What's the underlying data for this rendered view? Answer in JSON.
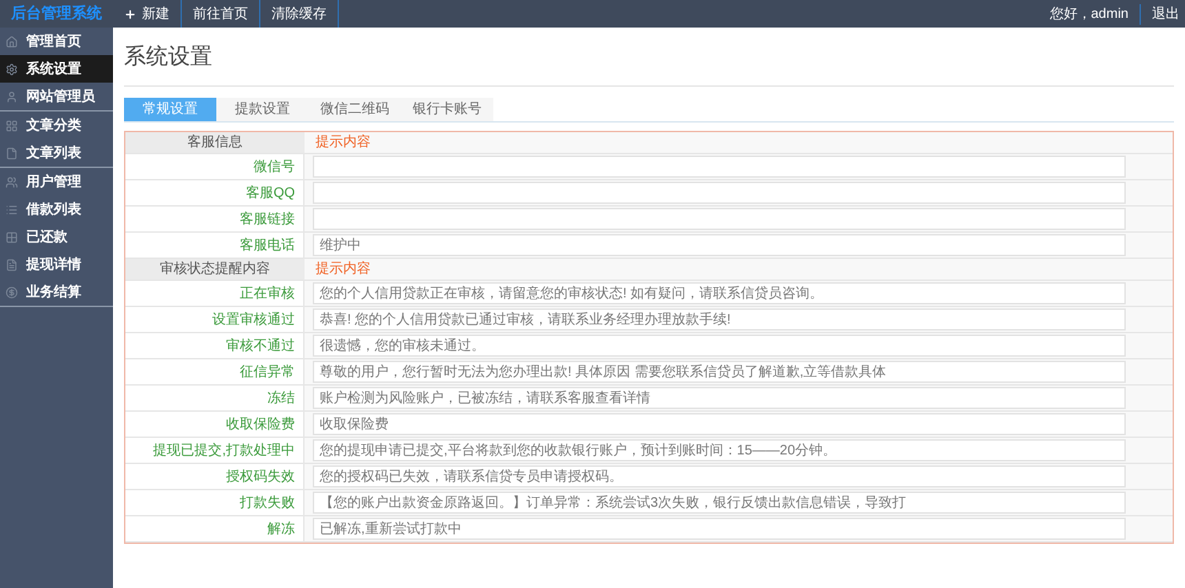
{
  "app": {
    "logo": "后台管理系统"
  },
  "toolbar": [
    {
      "kind": "new",
      "label": "新建"
    },
    {
      "kind": "link",
      "label": "前往首页"
    },
    {
      "kind": "link",
      "label": "清除缓存"
    }
  ],
  "user": {
    "greeting": "您好，admin",
    "logout": "退出"
  },
  "sidebar": {
    "groups": [
      [
        {
          "label": "管理首页",
          "selected": false
        },
        {
          "label": "系统设置",
          "selected": true
        },
        {
          "label": "网站管理员",
          "selected": false
        }
      ],
      [
        {
          "label": "文章分类",
          "selected": false
        },
        {
          "label": "文章列表",
          "selected": false
        }
      ],
      [
        {
          "label": "用户管理",
          "selected": false
        },
        {
          "label": "借款列表",
          "selected": false
        },
        {
          "label": "已还款",
          "selected": false
        },
        {
          "label": "提现详情",
          "selected": false
        },
        {
          "label": "业务结算",
          "selected": false
        }
      ]
    ]
  },
  "page": {
    "title": "系统设置"
  },
  "tabs": [
    {
      "label": "常规设置",
      "selected": true
    },
    {
      "label": "提款设置",
      "selected": false
    },
    {
      "label": "微信二维码",
      "selected": false
    },
    {
      "label": "银行卡账号",
      "selected": false
    }
  ],
  "form": {
    "rows": [
      {
        "kind": "section",
        "label": "客服信息",
        "hint": "提示内容"
      },
      {
        "kind": "field",
        "label": "微信号"
      },
      {
        "kind": "field",
        "label": "客服QQ"
      },
      {
        "kind": "field",
        "label": "客服链接"
      },
      {
        "kind": "field",
        "label": "客服电话",
        "value": "维护中"
      },
      {
        "kind": "section",
        "label": "审核状态提醒内容",
        "hint": "提示内容"
      },
      {
        "kind": "field",
        "label": "正在审核",
        "value": "您的个人信用贷款正在审核，请留意您的审核状态! 如有疑问，请联系信贷员咨询。"
      },
      {
        "kind": "field",
        "label": "设置审核通过",
        "value": "恭喜! 您的个人信用贷款已通过审核，请联系业务经理办理放款手续!"
      },
      {
        "kind": "field",
        "label": "审核不通过",
        "value": "很遗憾，您的审核未通过。"
      },
      {
        "kind": "field",
        "label": "征信异常",
        "value": "尊敬的用户，您行暂时无法为您办理出款! 具体原因 需要您联系信贷员了解道歉,立等借款具体"
      },
      {
        "kind": "field",
        "label": "冻结",
        "value": "账户检测为风险账户，已被冻结，请联系客服查看详情"
      },
      {
        "kind": "field",
        "label": "收取保险费",
        "value": "收取保险费"
      },
      {
        "kind": "field",
        "label": "提现已提交,打款处理中",
        "value": "您的提现申请已提交,平台将款到您的收款银行账户，预计到账时间：15——20分钟。"
      },
      {
        "kind": "field",
        "label": "授权码失效",
        "value": "您的授权码已失效，请联系信贷专员申请授权码。"
      },
      {
        "kind": "field",
        "label": "打款失败",
        "value": "【您的账户出款资金原路返回。】订单异常：系统尝试3次失败，银行反馈出款信息错误，导致打"
      },
      {
        "kind": "field",
        "label": "解冻",
        "value": "已解冻,重新尝试打款中"
      }
    ]
  }
}
